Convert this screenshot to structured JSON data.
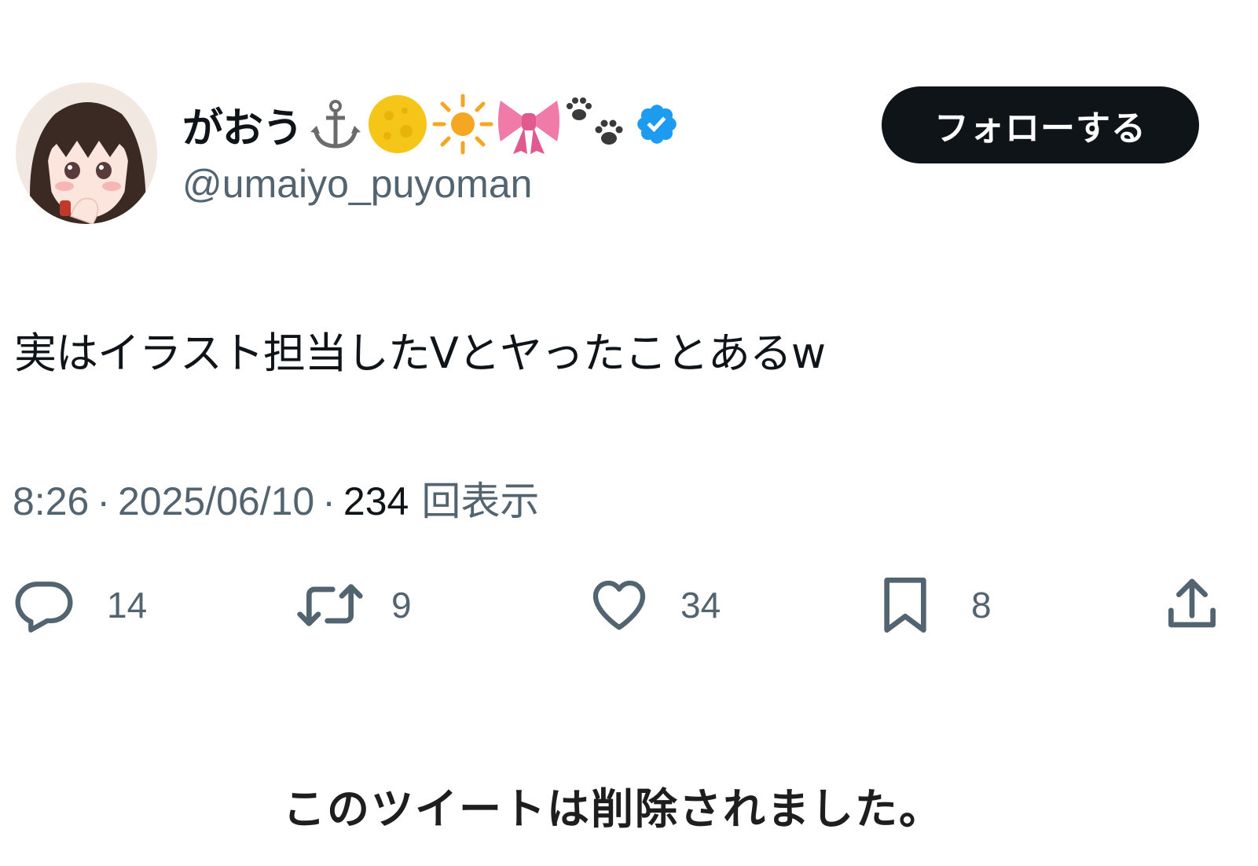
{
  "author": {
    "display_name": "がおう",
    "name_emojis": [
      "anchor-emoji",
      "full-moon-emoji",
      "sun-emoji",
      "ribbon-emoji",
      "paw-prints-emoji"
    ],
    "handle": "@umaiyo_puyoman",
    "verified": true,
    "verified_color": "#1d9bf0"
  },
  "follow_button": {
    "label": "フォローする",
    "bg_color": "#0f1419"
  },
  "tweet": {
    "text": "実はイラスト担当したVとヤったことあるw",
    "time": "8:26",
    "date": "2025/06/10",
    "views_count": "234",
    "views_label": "回表示"
  },
  "actions": {
    "replies": "14",
    "retweets": "9",
    "likes": "34",
    "bookmarks": "8"
  },
  "notice": {
    "text": "このツイートは削除されました。"
  },
  "colors": {
    "text_primary": "#0f1419",
    "text_secondary": "#536471"
  }
}
